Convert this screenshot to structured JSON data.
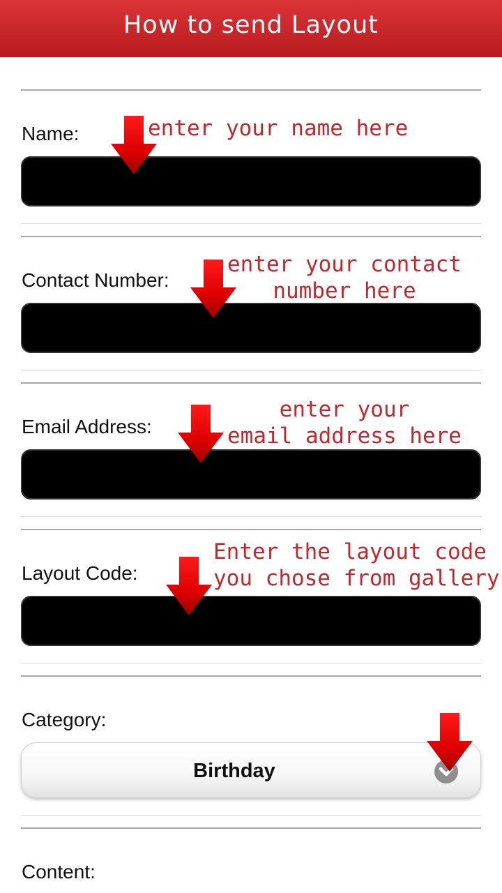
{
  "header": {
    "title": "How to send Layout"
  },
  "form": {
    "name": {
      "label": "Name:",
      "value": ""
    },
    "contact": {
      "label": "Contact Number:",
      "value": ""
    },
    "email": {
      "label": "Email Address:",
      "value": ""
    },
    "layout_code": {
      "label": "Layout Code:",
      "value": ""
    },
    "category": {
      "label": "Category:",
      "selected": "Birthday"
    },
    "content": {
      "label": "Content:"
    }
  },
  "hints": {
    "name": [
      "enter your name here"
    ],
    "contact": [
      "enter your contact",
      "number here"
    ],
    "email": [
      "enter your",
      "email address here"
    ],
    "layout_code": [
      "Enter the layout code",
      "you chose from gallery"
    ]
  },
  "icons": {
    "arrow": "red-down-arrow-icon",
    "dropdown": "chevron-down-circle-icon"
  },
  "colors": {
    "header_bg": "#c8262a",
    "hint_text": "#c1272d",
    "arrow": "#e00000",
    "field_bg": "#000000"
  }
}
